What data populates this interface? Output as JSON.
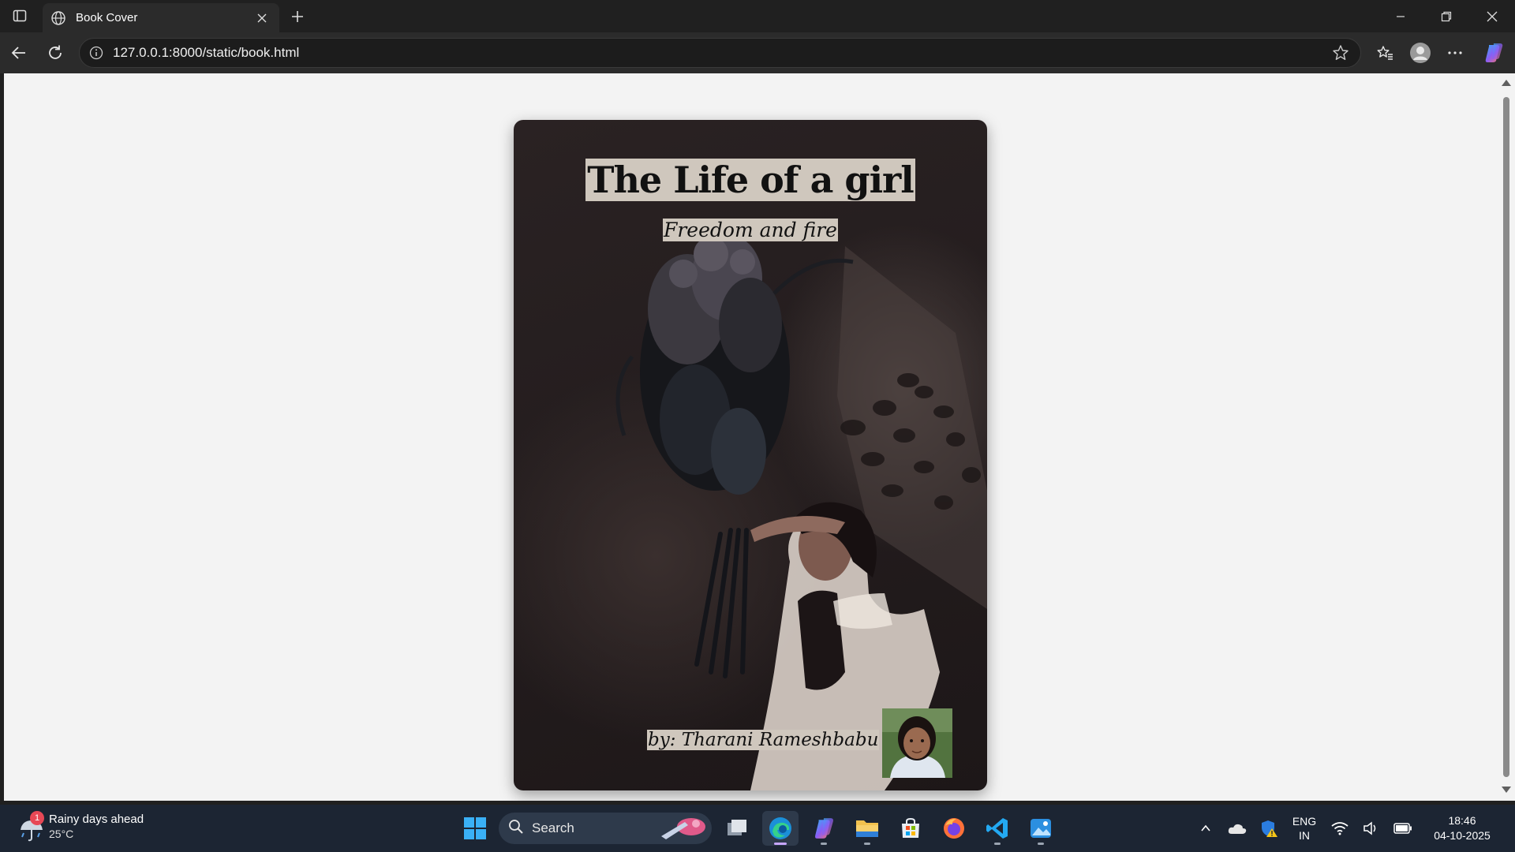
{
  "browser": {
    "tab_title": "Book Cover",
    "url": "127.0.0.1:8000/static/book.html"
  },
  "book": {
    "title": "The Life of a girl",
    "subtitle": "Freedom and fire",
    "author": "by: Tharani Rameshbabu"
  },
  "taskbar": {
    "weather_title": "Rainy days ahead",
    "weather_temp": "25°C",
    "weather_badge": "1",
    "search_label": "Search",
    "lang_line1": "ENG",
    "lang_line2": "IN",
    "time": "18:46",
    "date": "04-10-2025"
  }
}
